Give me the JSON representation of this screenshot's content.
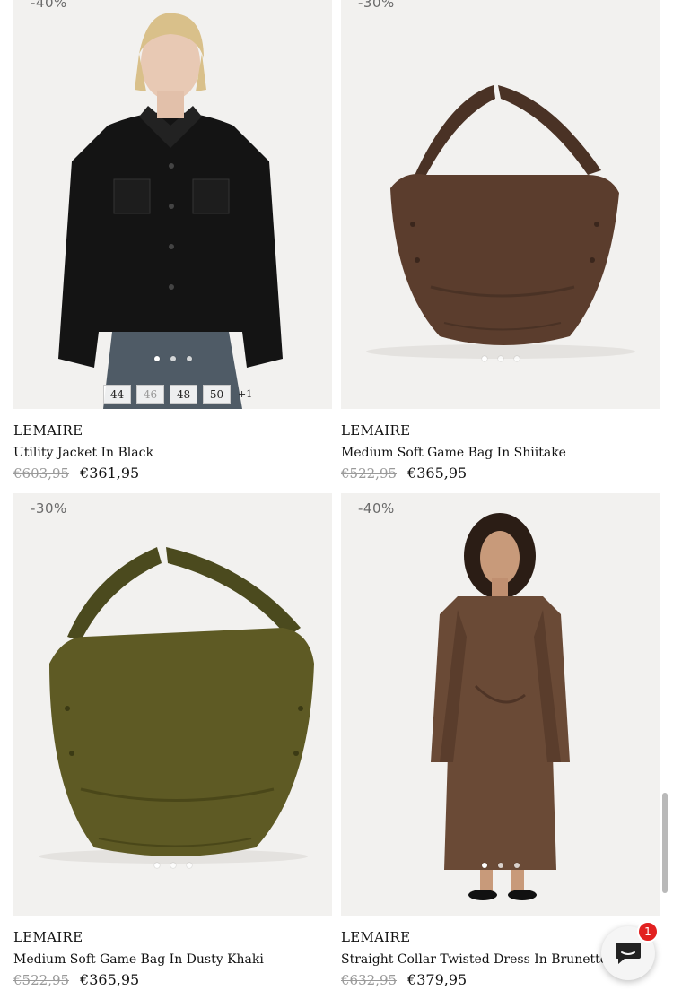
{
  "products": [
    {
      "badge": "-40%",
      "brand": "LEMAIRE",
      "title": "Utility Jacket In Black",
      "old_price": "€603,95",
      "new_price": "€361,95",
      "sizes": [
        "44",
        "46",
        "48",
        "50"
      ],
      "sizes_more": "+1",
      "image": "black-utility-jacket-photo"
    },
    {
      "badge": "-30%",
      "brand": "LEMAIRE",
      "title": "Medium Soft Game Bag In Shiitake",
      "old_price": "€522,95",
      "new_price": "€365,95",
      "image": "brown-soft-game-bag-photo"
    },
    {
      "badge": "-30%",
      "brand": "LEMAIRE",
      "title": "Medium Soft Game Bag In Dusty Khaki",
      "old_price": "€522,95",
      "new_price": "€365,95",
      "image": "khaki-soft-game-bag-photo"
    },
    {
      "badge": "-40%",
      "brand": "LEMAIRE",
      "title": "Straight Collar Twisted Dress In Brunette",
      "old_price": "€632,95",
      "new_price": "€379,95",
      "image": "brown-twisted-dress-photo"
    }
  ],
  "chat": {
    "icon": "chat-bubble-icon",
    "badge_count": "1",
    "badge_color": "#e22120"
  },
  "colors": {
    "text": "#111111",
    "muted_price": "#9a9a9a",
    "image_bg": "#f0efed"
  }
}
